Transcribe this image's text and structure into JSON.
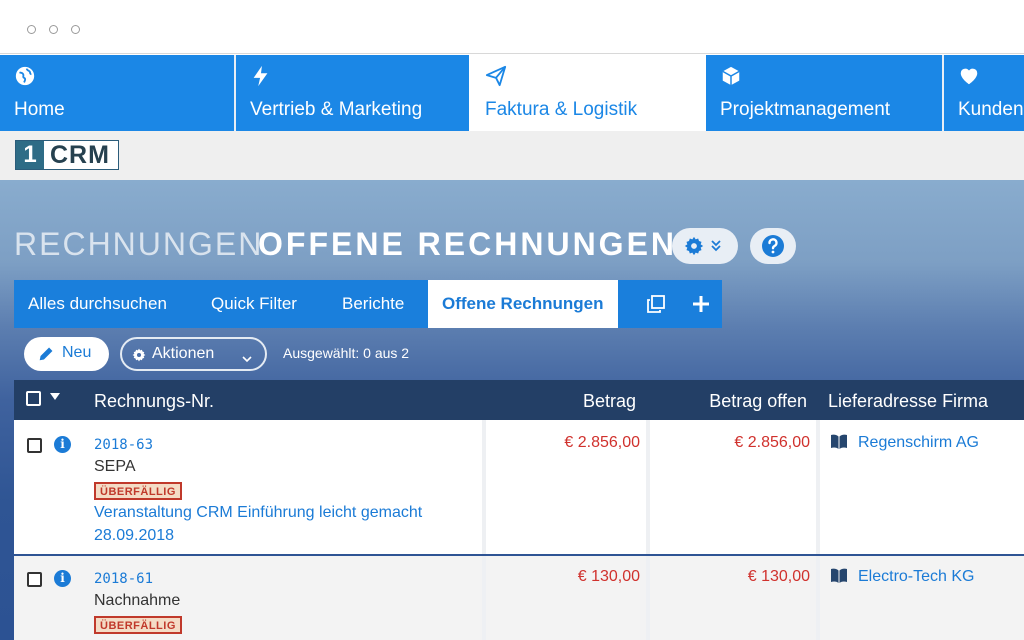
{
  "nav": {
    "tabs": [
      {
        "label": "Home",
        "icon": "globe-icon"
      },
      {
        "label": "Vertrieb & Marketing",
        "icon": "lightning-icon"
      },
      {
        "label": "Faktura & Logistik",
        "icon": "paper-plane-icon"
      },
      {
        "label": "Projektmanagement",
        "icon": "cube-icon"
      },
      {
        "label": "Kunden",
        "icon": "heart-icon"
      }
    ],
    "active_index": 2
  },
  "logo": {
    "number": "1",
    "text": "CRM"
  },
  "header": {
    "module": "RECHNUNGEN",
    "view": "OFFENE RECHNUNGEN"
  },
  "subnav": {
    "items": [
      "Alles durchsuchen",
      "Quick Filter",
      "Berichte",
      "Offene Rechnungen"
    ],
    "active": "Offene Rechnungen"
  },
  "actions": {
    "new_label": "Neu",
    "actions_label": "Aktionen",
    "selected_text": "Ausgewählt: 0 aus 2"
  },
  "table": {
    "columns": [
      "Rechnungs-Nr.",
      "Betrag",
      "Betrag offen",
      "Lieferadresse Firma"
    ],
    "rows": [
      {
        "number": "2018-63",
        "payment": "SEPA",
        "badge": "ÜBERFÄLLIG",
        "subject": "Veranstaltung CRM Einführung leicht gemacht",
        "date": "28.09.2018",
        "amount": "€ 2.856,00",
        "amount_open": "€ 2.856,00",
        "company": "Regenschirm AG"
      },
      {
        "number": "2018-61",
        "payment": "Nachnahme",
        "badge": "ÜBERFÄLLIG",
        "amount": "€ 130,00",
        "amount_open": "€ 130,00",
        "company": "Electro-Tech KG"
      }
    ]
  },
  "colors": {
    "accent": "#1b87e6",
    "header_dark": "#233f66",
    "amount": "#d0312d",
    "badge": "#c0392b"
  }
}
